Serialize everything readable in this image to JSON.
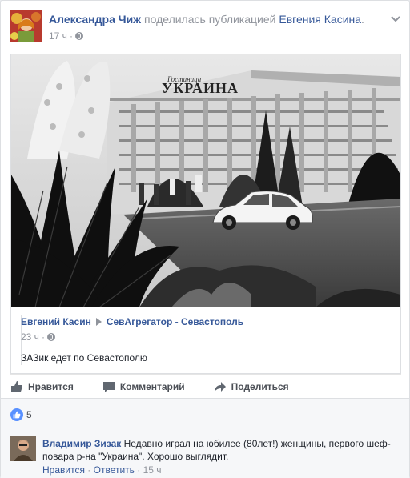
{
  "post": {
    "author": "Александра Чиж",
    "action": "поделилась публикацией",
    "target": "Евгения Касина",
    "period": ".",
    "time": "17 ч",
    "dot": "·"
  },
  "shared": {
    "author": "Евгений Касин",
    "group": "СевАгрегатор - Севастополь",
    "time": "23 ч",
    "dot": "·",
    "message": "ЗАЗик едет по Севастополю",
    "image_sign": "УКРАИНА",
    "image_sign_small": "Гостиница"
  },
  "actions": {
    "like": "Нравится",
    "comment": "Комментарий",
    "share": "Поделиться"
  },
  "likes": {
    "count": "5"
  },
  "comment": {
    "author": "Владимир Зизак",
    "text": "Недавно играл на юбилее (80лет!) женщины, первого шеф-повара р-на \"Украина\". Хорошо выглядит.",
    "like": "Нравится",
    "reply": "Ответить",
    "sep": "·",
    "time": "15 ч"
  },
  "colors": {
    "link": "#365899",
    "meta": "#90949c",
    "like_badge": "#5890ff"
  }
}
